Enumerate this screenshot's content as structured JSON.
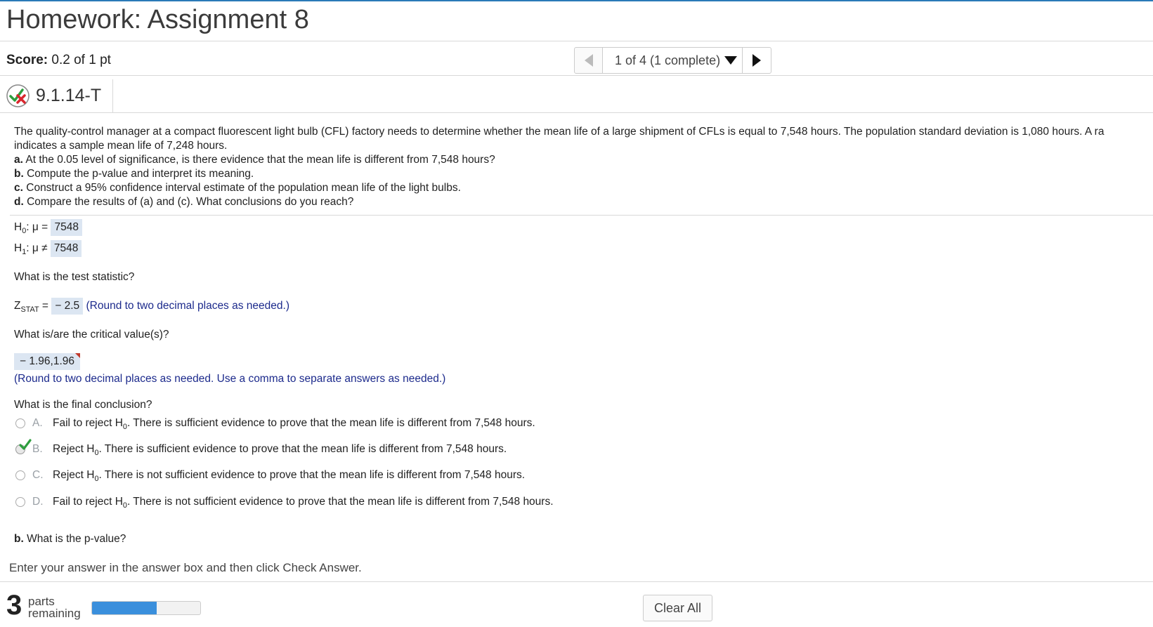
{
  "header": {
    "title": "Homework: Assignment 8"
  },
  "score": {
    "label": "Score:",
    "value": "0.2 of 1 pt"
  },
  "nav": {
    "position": "1 of 4 (1 complete)"
  },
  "question": {
    "id": "9.1.14-T"
  },
  "problem": {
    "line1": "The quality-control manager at a compact fluorescent light bulb (CFL) factory needs to determine whether the mean life of a large shipment of CFLs is equal to 7,548 hours. The population standard deviation is 1,080 hours. A ra",
    "line2": "indicates a sample mean life of 7,248 hours.",
    "parts": [
      {
        "label": "a.",
        "text": "At the 0.05 level of significance, is there evidence that the mean life is different from 7,548 hours?"
      },
      {
        "label": "b.",
        "text": "Compute the p-value and interpret its meaning."
      },
      {
        "label": "c.",
        "text": "Construct a 95% confidence interval estimate of the population mean life of the light bulbs."
      },
      {
        "label": "d.",
        "text": "Compare the results of (a) and (c). What conclusions do you reach?"
      }
    ]
  },
  "hypotheses": {
    "h0_label": "H",
    "h0_sub": "0",
    "h0_rel": ": μ =",
    "h0_value": "7548",
    "h1_label": "H",
    "h1_sub": "1",
    "h1_rel": ": μ ≠",
    "h1_value": "7548"
  },
  "test_stat": {
    "question": "What is the test statistic?",
    "label": "Z",
    "label_sub": "STAT",
    "eq": "=",
    "value": "− 2.5",
    "hint": "(Round to two decimal places as needed.)"
  },
  "critical": {
    "question": "What is/are the critical value(s)?",
    "value": "− 1.96,1.96",
    "hint": "(Round to two decimal places as needed. Use a comma to separate answers as needed.)"
  },
  "conclusion": {
    "question": "What is the final conclusion?",
    "options": [
      {
        "letter": "A.",
        "pre": "Fail to reject H",
        "sub": "0",
        "post": ". There is sufficient evidence to prove that the mean life is different from 7,548 hours."
      },
      {
        "letter": "B.",
        "pre": "Reject H",
        "sub": "0",
        "post": ". There is sufficient evidence to prove that the mean life is different from 7,548 hours."
      },
      {
        "letter": "C.",
        "pre": "Reject H",
        "sub": "0",
        "post": ". There is not sufficient evidence to prove that the mean life is different from 7,548 hours."
      },
      {
        "letter": "D.",
        "pre": "Fail to reject H",
        "sub": "0",
        "post": ". There is not sufficient evidence to prove that the mean life is different from 7,548 hours."
      }
    ]
  },
  "pvalue": {
    "label": "b.",
    "question": "What is the p-value?"
  },
  "instructions": "Enter your answer in the answer box and then click Check Answer.",
  "footer": {
    "parts_count": "3",
    "parts_word1": "parts",
    "parts_word2": "remaining",
    "progress_fraction": 0.6,
    "clear_label": "Clear All"
  },
  "colors": {
    "accent": "#2a7ab8",
    "answer_bg": "#dce6f2",
    "progress": "#3a8fdc",
    "check": "#2e9e3e",
    "cross": "#d9262d"
  }
}
